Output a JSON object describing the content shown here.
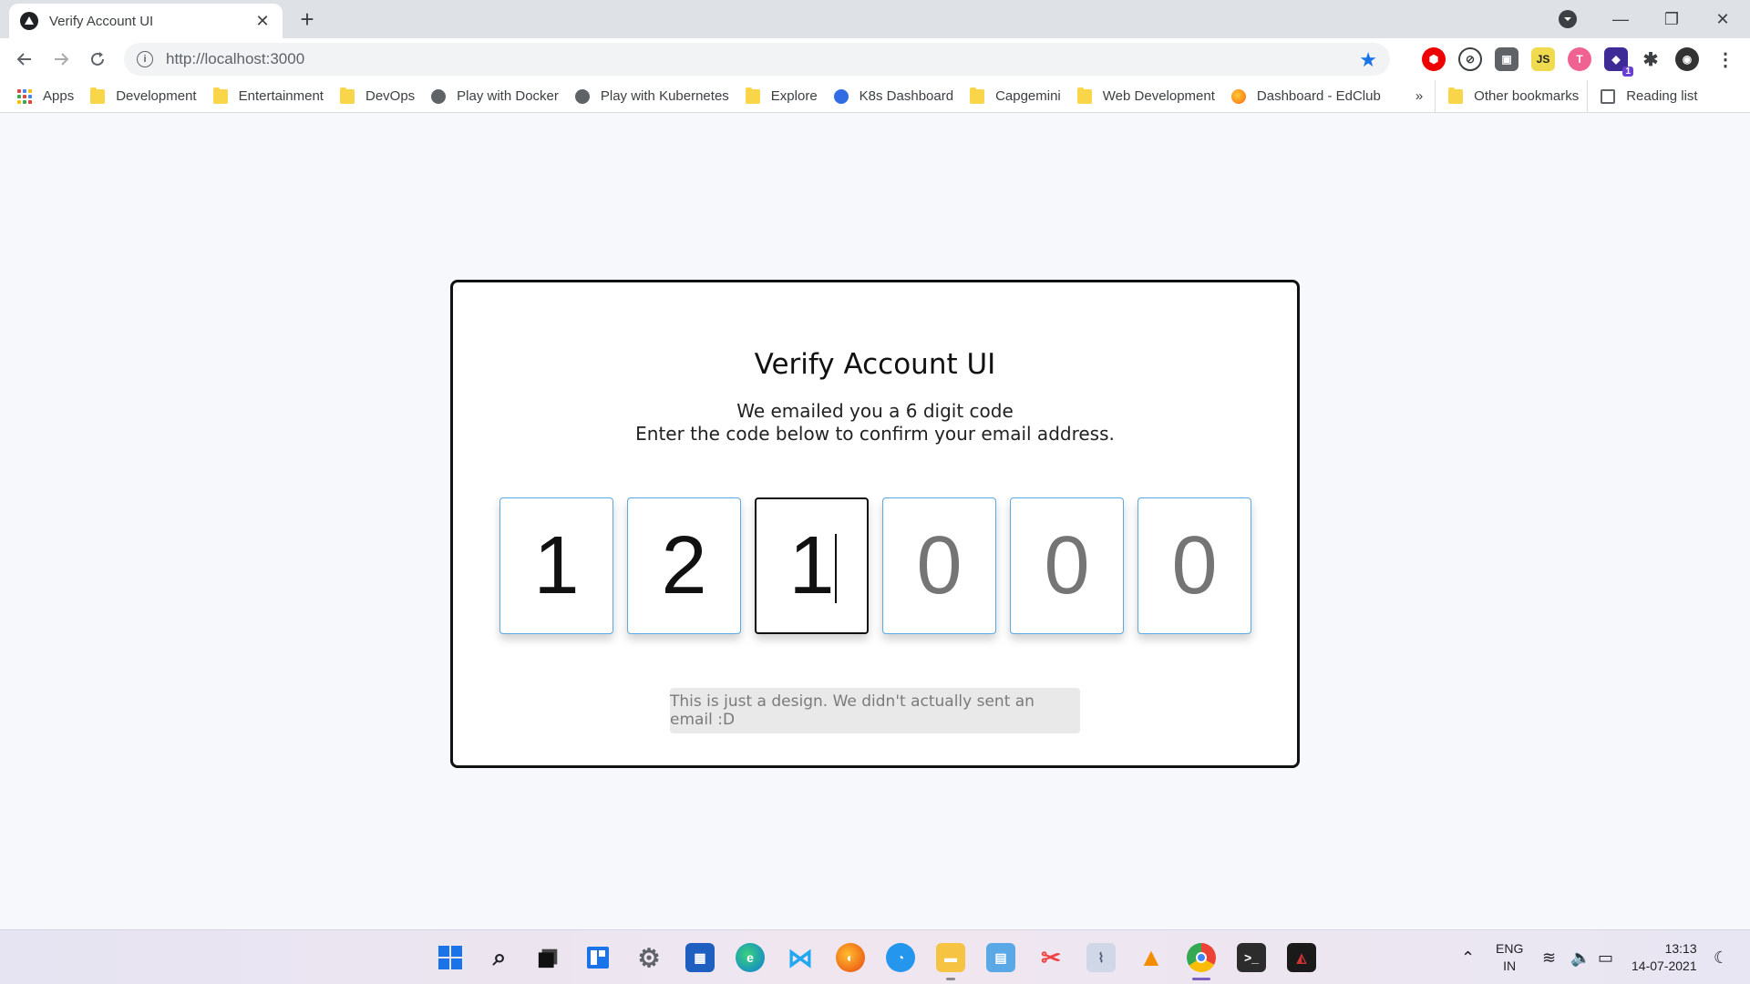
{
  "browser": {
    "tab_title": "Verify Account UI",
    "url": "http://localhost:3000",
    "bookmarks": [
      {
        "label": "Apps",
        "icon": "apps-grid-icon"
      },
      {
        "label": "Development",
        "icon": "folder-icon"
      },
      {
        "label": "Entertainment",
        "icon": "folder-icon"
      },
      {
        "label": "DevOps",
        "icon": "folder-icon"
      },
      {
        "label": "Play with Docker",
        "icon": "globe-icon"
      },
      {
        "label": "Play with Kubernetes",
        "icon": "globe-icon"
      },
      {
        "label": "Explore",
        "icon": "folder-icon"
      },
      {
        "label": "K8s Dashboard",
        "icon": "kubernetes-icon"
      },
      {
        "label": "Capgemini",
        "icon": "folder-icon"
      },
      {
        "label": "Web Development",
        "icon": "folder-icon"
      },
      {
        "label": "Dashboard - EdClub",
        "icon": "edclub-icon"
      }
    ],
    "overflow_label": "»",
    "other_bookmarks": "Other bookmarks",
    "reading_list": "Reading list",
    "extension_badge": "1"
  },
  "card": {
    "title": "Verify Account UI",
    "subtitle_line1": "We emailed you a 6 digit code",
    "subtitle_line2": "Enter the code below to confirm your email address.",
    "digits": [
      {
        "value": "1",
        "filled": true
      },
      {
        "value": "2",
        "filled": true
      },
      {
        "value": "1",
        "filled": true,
        "focused": true
      },
      {
        "value": "0",
        "filled": false
      },
      {
        "value": "0",
        "filled": false
      },
      {
        "value": "0",
        "filled": false
      }
    ],
    "note": "This is just a design. We didn't actually sent an email :D"
  },
  "taskbar": {
    "lang_line1": "ENG",
    "lang_line2": "IN",
    "time": "13:13",
    "date": "14-07-2021"
  },
  "colors": {
    "digit_border": "#5aa9e6",
    "star": "#1a73e8",
    "card_border": "#111111"
  }
}
